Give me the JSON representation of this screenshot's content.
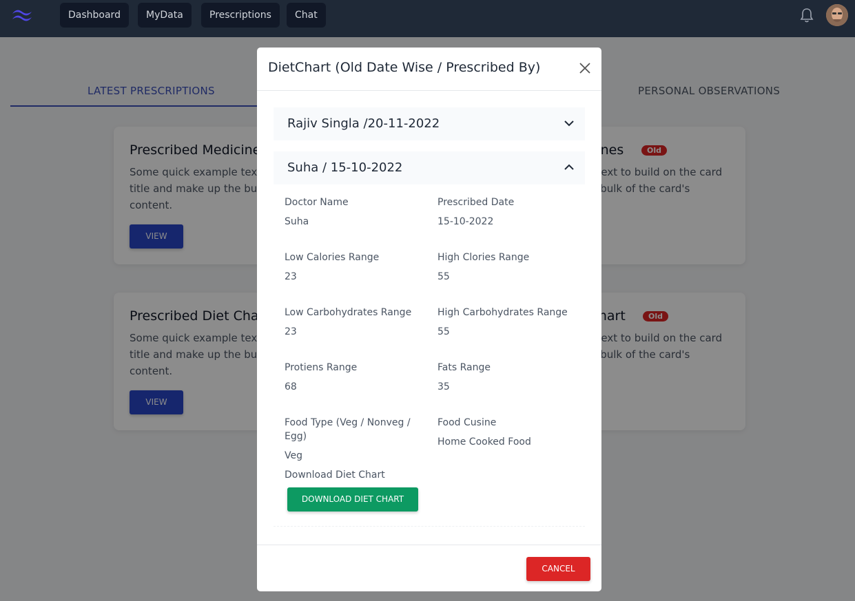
{
  "nav": {
    "items": [
      {
        "label": "Dashboard"
      },
      {
        "label": "MyData"
      },
      {
        "label": "Prescriptions"
      },
      {
        "label": "Chat"
      }
    ],
    "logo_icon": "tailwind-logo-icon",
    "notification_icon": "bell-icon"
  },
  "tabs": {
    "latest": "LATEST PRESCRIPTIONS",
    "observations": "PERSONAL OBSERVATIONS"
  },
  "cards": {
    "medicine_latest": {
      "title": "Prescribed Medicines",
      "text": "Some quick example text to build on the card title and make up the bulk of the card's content.",
      "button": "VIEW"
    },
    "medicine_old": {
      "title": "Prescribed Medicines",
      "badge": "Old",
      "text": "Some quick example text to build on the card title and make up the bulk of the card's content."
    },
    "diet_latest": {
      "title": "Prescribed Diet Chart",
      "text": "Some quick example text to build on the card title and make up the bulk of the card's content.",
      "button": "VIEW"
    },
    "diet_old": {
      "title": "Prescribed Diet Chart",
      "badge": "Old",
      "text": "Some quick example text to build on the card title and make up the bulk of the card's content."
    }
  },
  "modal": {
    "title": "DietChart (Old Date Wise / Prescribed By)",
    "accordion": [
      {
        "label": "Rajiv Singla /20-11-2022",
        "expanded": false
      },
      {
        "label": "Suha / 15-10-2022",
        "expanded": true
      }
    ],
    "fields": {
      "doctor_name": {
        "label": "Doctor Name",
        "value": "Suha"
      },
      "prescribed_date": {
        "label": "Prescribed Date",
        "value": "15-10-2022"
      },
      "low_calories": {
        "label": "Low Calories Range",
        "value": "23"
      },
      "high_calories": {
        "label": "High Clories Range",
        "value": "55"
      },
      "low_carbs": {
        "label": "Low Carbohydrates Range",
        "value": "23"
      },
      "high_carbs": {
        "label": "High Carbohydrates Range",
        "value": "55"
      },
      "proteins": {
        "label": "Protiens Range",
        "value": "68"
      },
      "fats": {
        "label": "Fats Range",
        "value": "35"
      },
      "food_type": {
        "label_line1": "Food Type (Veg / Nonveg /",
        "label_line2": "Egg)",
        "value": "Veg"
      },
      "food_cuisine": {
        "label": "Food Cusine",
        "value": "Home Cooked Food"
      },
      "download": {
        "label": "Download Diet Chart",
        "button": "DOWNLOAD DIET CHART"
      }
    },
    "cancel": "CANCEL"
  },
  "colors": {
    "navbar": "#1f2937",
    "primary": "#2845c7",
    "success": "#0d9a62",
    "danger": "#dc2626"
  }
}
